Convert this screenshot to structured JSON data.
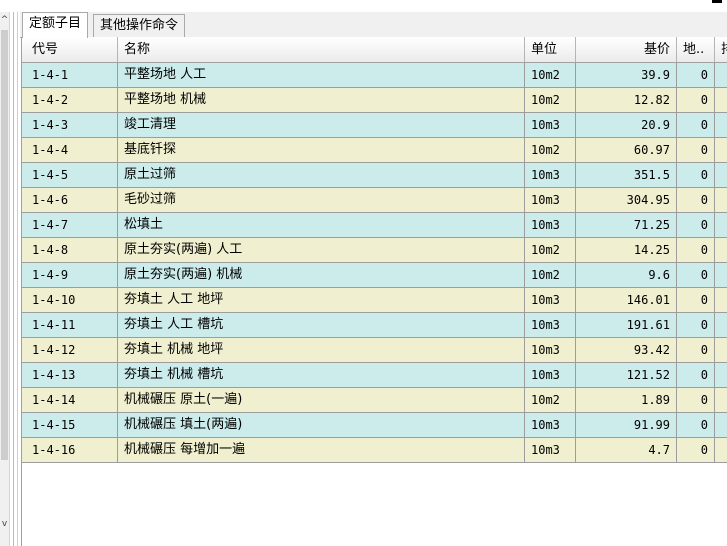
{
  "tabs": [
    {
      "label": "定额子目",
      "active": true
    },
    {
      "label": "其他操作命令",
      "active": false
    }
  ],
  "scrollbar": {
    "up_arrow": "^",
    "down_arrow": "v"
  },
  "table": {
    "headers": {
      "code": "代号",
      "name": "名称",
      "unit": "单位",
      "price": "基价",
      "land": "地..",
      "extra": "排"
    },
    "rows": [
      {
        "code": "1-4-1",
        "name": "平整场地 人工",
        "unit": "10m2",
        "price": "39.9",
        "land": "0"
      },
      {
        "code": "1-4-2",
        "name": "平整场地 机械",
        "unit": "10m2",
        "price": "12.82",
        "land": "0"
      },
      {
        "code": "1-4-3",
        "name": "竣工清理",
        "unit": "10m3",
        "price": "20.9",
        "land": "0"
      },
      {
        "code": "1-4-4",
        "name": "基底钎探",
        "unit": "10m2",
        "price": "60.97",
        "land": "0"
      },
      {
        "code": "1-4-5",
        "name": "原土过筛",
        "unit": "10m3",
        "price": "351.5",
        "land": "0"
      },
      {
        "code": "1-4-6",
        "name": "毛砂过筛",
        "unit": "10m3",
        "price": "304.95",
        "land": "0"
      },
      {
        "code": "1-4-7",
        "name": "松填土",
        "unit": "10m3",
        "price": "71.25",
        "land": "0"
      },
      {
        "code": "1-4-8",
        "name": "原土夯实(两遍) 人工",
        "unit": "10m2",
        "price": "14.25",
        "land": "0"
      },
      {
        "code": "1-4-9",
        "name": "原土夯实(两遍) 机械",
        "unit": "10m2",
        "price": "9.6",
        "land": "0"
      },
      {
        "code": "1-4-10",
        "name": "夯填土 人工 地坪",
        "unit": "10m3",
        "price": "146.01",
        "land": "0"
      },
      {
        "code": "1-4-11",
        "name": "夯填土 人工 槽坑",
        "unit": "10m3",
        "price": "191.61",
        "land": "0"
      },
      {
        "code": "1-4-12",
        "name": "夯填土 机械 地坪",
        "unit": "10m3",
        "price": "93.42",
        "land": "0"
      },
      {
        "code": "1-4-13",
        "name": "夯填土 机械 槽坑",
        "unit": "10m3",
        "price": "121.52",
        "land": "0"
      },
      {
        "code": "1-4-14",
        "name": "机械碾压 原土(一遍)",
        "unit": "10m2",
        "price": "1.89",
        "land": "0"
      },
      {
        "code": "1-4-15",
        "name": "机械碾压 填土(两遍)",
        "unit": "10m3",
        "price": "91.99",
        "land": "0"
      },
      {
        "code": "1-4-16",
        "name": "机械碾压 每增加一遍",
        "unit": "10m3",
        "price": "4.7",
        "land": "0"
      }
    ]
  },
  "colors": {
    "row_even": "#ccecec",
    "row_odd": "#f0efcf",
    "grid_line": "#9d9d9d"
  }
}
